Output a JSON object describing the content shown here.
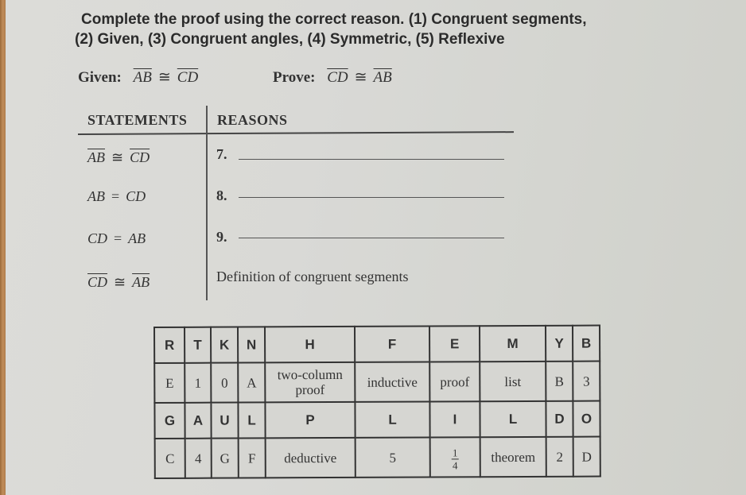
{
  "instructions": {
    "line1": "Complete the proof using the correct reason. (1) Congruent segments,",
    "line2": "(2) Given, (3) Congruent angles, (4) Symmetric, (5) Reflexive"
  },
  "given": {
    "label": "Given:",
    "left": "AB",
    "symbol": "≅",
    "right": "CD"
  },
  "prove": {
    "label": "Prove:",
    "left": "CD",
    "symbol": "≅",
    "right": "AB"
  },
  "proof_table": {
    "headers": {
      "statements": "STATEMENTS",
      "reasons": "REASONS"
    },
    "rows": [
      {
        "statement_left": "AB",
        "relation": "≅",
        "statement_right": "CD",
        "overline": true,
        "reason_number": "7.",
        "reason": ""
      },
      {
        "statement_left": "AB",
        "relation": "=",
        "statement_right": "CD",
        "overline": false,
        "reason_number": "8.",
        "reason": ""
      },
      {
        "statement_left": "CD",
        "relation": "=",
        "statement_right": "AB",
        "overline": false,
        "reason_number": "9.",
        "reason": ""
      },
      {
        "statement_left": "CD",
        "relation": "≅",
        "statement_right": "AB",
        "overline": true,
        "reason_number": "",
        "reason": "Definition of congruent segments"
      }
    ]
  },
  "code_table": {
    "rows": [
      {
        "letters": [
          "R",
          "T",
          "K",
          "N",
          "H",
          "F",
          "E",
          "M",
          "Y",
          "B"
        ],
        "values": [
          "E",
          "1",
          "0",
          "A",
          "two-column proof",
          "inductive",
          "proof",
          "list",
          "B",
          "3"
        ]
      },
      {
        "letters": [
          "G",
          "A",
          "U",
          "L",
          "P",
          "L",
          "I",
          "L",
          "D",
          "O"
        ],
        "values": [
          "C",
          "4",
          "G",
          "F",
          "deductive",
          "5",
          "1/4",
          "theorem",
          "2",
          "D"
        ]
      }
    ],
    "fraction": {
      "numerator": "1",
      "denominator": "4"
    }
  }
}
